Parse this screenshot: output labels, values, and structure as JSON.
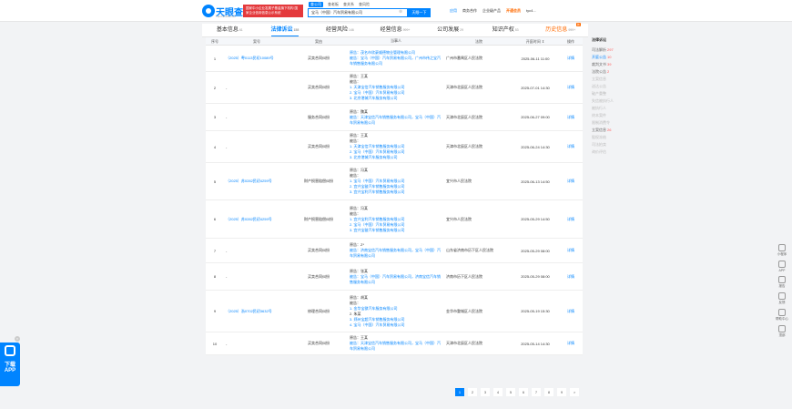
{
  "header": {
    "logo_text": "天眼查",
    "logo_sub": "TianYancha.com",
    "ad_text": "国家中小企业发展子基金旗下机构 国家企业信用信息公示系统",
    "search_tabs": [
      "查公司",
      "查老板",
      "查关系",
      "查风险"
    ],
    "search_value": "宝马（中国）汽车贸易有限公司",
    "search_button": "天眼一下",
    "nav": [
      "应用",
      "商务合作",
      "企业级产品",
      "开通会员",
      "tyc4..."
    ]
  },
  "tabs": [
    {
      "label": "基本信息",
      "count": "61"
    },
    {
      "label": "法律诉讼",
      "count": "158"
    },
    {
      "label": "经营风险",
      "count": "146"
    },
    {
      "label": "经营信息",
      "count": "999+"
    },
    {
      "label": "公司发展",
      "count": "29"
    },
    {
      "label": "知识产权",
      "count": "53"
    },
    {
      "label": "历史信息",
      "count": "999+",
      "badge": "新"
    }
  ],
  "table": {
    "headers": [
      "序号",
      "案号",
      "案由",
      "当事人",
      "法院",
      "开庭时间",
      "操作"
    ],
    "rows": [
      {
        "no": "1",
        "case": "（2025）粤0113民初10089号",
        "type": "买卖合同纠纷",
        "parties": [
          "原告：茂名市欣豪顺德物业管理有限公司",
          "被告：宝马（中国）汽车贸易有限公司，广州市伟之宝汽车销售服务有限公司"
        ],
        "court": "广州市番禺区人民法院",
        "date": "2025-06-11 11:00",
        "op": "详情"
      },
      {
        "no": "2",
        "case": "-",
        "type": "买卖合同纠纷",
        "parties": [
          "原告：王某",
          "被告：",
          "1. 天津宝信汽车销售服务有限公司",
          "2. 宝马（中国）汽车贸易有限公司",
          "3. 北京港城汽车服务有限公司"
        ],
        "court": "天津市北辰区人民法院",
        "date": "2025-07-01 14:30",
        "op": "详情"
      },
      {
        "no": "3",
        "case": "-",
        "type": "服务合同纠纷",
        "parties": [
          "原告：魏某",
          "被告：天津宝信汽车销售服务有限公司，宝马（中国）汽车贸易有限公司"
        ],
        "court": "天津市北辰区人民法院",
        "date": "2025-06-27 09:00",
        "op": "详情"
      },
      {
        "no": "4",
        "case": "-",
        "type": "买卖合同纠纷",
        "parties": [
          "原告：王某",
          "被告：",
          "1. 天津宝信汽车销售服务有限公司",
          "2. 宝马（中国）汽车贸易有限公司",
          "3. 北京港城汽车服务有限公司"
        ],
        "court": "天津市北辰区人民法院",
        "date": "2025-06-24 14:30",
        "op": "详情"
      },
      {
        "no": "5",
        "case": "（2025）苏0282民初4259号",
        "type": "财产损害赔偿纠纷",
        "parties": [
          "原告：冯某",
          "被告：",
          "1. 宝马（中国）汽车贸易有限公司",
          "2. 宜兴宝骏汽车销售服务有限公司",
          "3. 宜兴宝利汽车销售服务有限公司"
        ],
        "court": "宜兴市人民法院",
        "date": "2025-06-13 14:50",
        "op": "详情"
      },
      {
        "no": "6",
        "case": "（2025）苏0282民初4259号",
        "type": "财产损害赔偿纠纷",
        "parties": [
          "原告：冯某",
          "被告：",
          "1. 宜兴宝利汽车销售服务有限公司",
          "2. 宝马（中国）汽车贸易有限公司",
          "3. 宜兴宝骏汽车销售服务有限公司"
        ],
        "court": "宜兴市人民法院",
        "date": "2025-05-29 14:50",
        "op": "详情"
      },
      {
        "no": "7",
        "case": "-",
        "type": "买卖合同纠纷",
        "parties": [
          "原告：Z*",
          "被告：济南宝信汽车销售服务有限公司，宝马（中国）汽车贸易有限公司"
        ],
        "court": "山东省济南市历下区人民法院",
        "date": "2025-05-29 08:00",
        "op": "详情"
      },
      {
        "no": "8",
        "case": "-",
        "type": "买卖合同纠纷",
        "parties": [
          "原告：张某",
          "被告：宝马（中国）汽车贸易有限公司，济南宝信汽车销售服务有限公司"
        ],
        "court": "济南市历下区人民法院",
        "date": "2025-05-29 08:00",
        "op": "详情"
      },
      {
        "no": "9",
        "case": "（2025）浙0702民初3632号",
        "type": "修理合同纠纷",
        "parties": [
          "原告：胡某",
          "被告：",
          "1. 金华宝骐汽车服务有限公司",
          "2. 朱某",
          "3. 郑州宝超汽车销售服务有限公司",
          "4. 宝马（中国）汽车贸易有限公司"
        ],
        "court": "金华市婺城区人民法院",
        "date": "2025-05-19 15:30",
        "op": "详情"
      },
      {
        "no": "10",
        "case": "-",
        "type": "买卖合同纠纷",
        "parties": [
          "原告：王某",
          "被告：天津宝信汽车销售服务有限公司，宝马（中国）汽车贸易有限公司"
        ],
        "court": "天津市北辰区人民法院",
        "date": "2025-05-14 14:30",
        "op": "详情"
      }
    ]
  },
  "pagination": [
    "1",
    "2",
    "3",
    "4",
    "5",
    "6",
    "7",
    "8",
    "9",
    ">"
  ],
  "side_filter": {
    "title": "法律诉讼",
    "items": [
      {
        "label": "司法解析",
        "count": "297",
        "state": "normal"
      },
      {
        "label": "开庭公告",
        "count": "10",
        "state": "on"
      },
      {
        "label": "裁判文书",
        "count": "39",
        "state": "normal"
      },
      {
        "label": "法院公告",
        "count": "2",
        "state": "normal"
      },
      {
        "label": "立案信息",
        "count": "",
        "state": "dim"
      },
      {
        "label": "送达公告",
        "count": "",
        "state": "dim"
      },
      {
        "label": "破产重整",
        "count": "",
        "state": "dim"
      },
      {
        "label": "失信被执行人",
        "count": "",
        "state": "dim"
      },
      {
        "label": "被执行人",
        "count": "",
        "state": "dim"
      },
      {
        "label": "终本案件",
        "count": "",
        "state": "dim"
      },
      {
        "label": "限制消费令",
        "count": "",
        "state": "dim"
      },
      {
        "label": "立案信息",
        "count": "26",
        "state": "normal"
      },
      {
        "label": "股权冻结",
        "count": "",
        "state": "dim"
      },
      {
        "label": "司法拍卖",
        "count": "",
        "state": "dim"
      },
      {
        "label": "询价评估",
        "count": "",
        "state": "dim"
      }
    ]
  },
  "float_right": [
    "小程序",
    "APP",
    "报告",
    "反馈",
    "帮助中心",
    "顶部"
  ],
  "app_float": {
    "label": "下载 APP"
  }
}
